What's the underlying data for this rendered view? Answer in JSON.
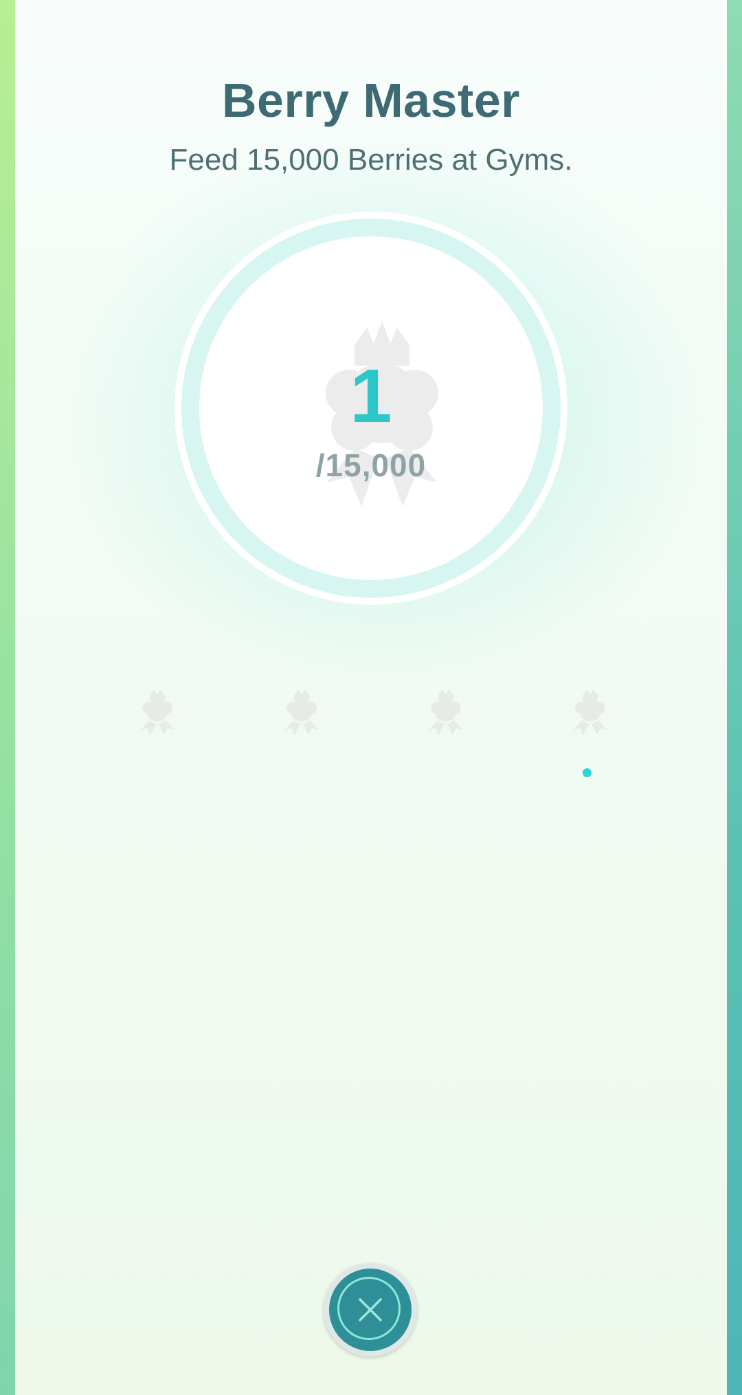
{
  "badge": {
    "title": "Berry Master",
    "description": "Feed 15,000 Berries at Gyms.",
    "progress_count": "1",
    "progress_goal": "/15,000",
    "progress_fraction": 6.67e-05
  },
  "icons": {
    "medal": "medal-silhouette-icon",
    "tier": "tier-medal-icon",
    "close": "close-icon"
  },
  "colors": {
    "accent": "#2ec7c9",
    "title": "#3e6a73",
    "button": "#2f8f98"
  }
}
